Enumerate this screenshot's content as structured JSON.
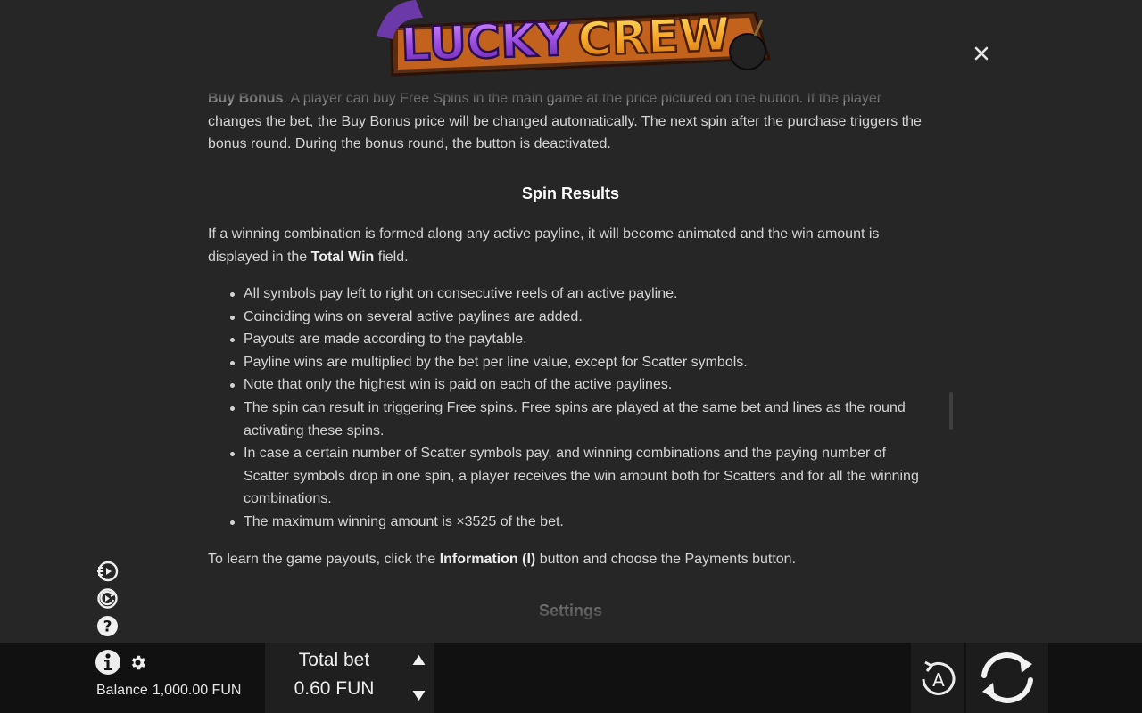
{
  "header": {
    "logo_word1": "LUCKY",
    "logo_word2": "CREW",
    "close_icon": "close-icon"
  },
  "rules": {
    "buy_bonus": {
      "term": "Buy Bonus",
      "text": ". A player can buy Free Spins in the main game at the price pictured on the button. If the player changes the bet, the Buy Bonus price will be changed automatically. The next spin after the purchase triggers the bonus round. During the bonus round, the button is deactivated."
    },
    "spin_results_heading": "Spin Results",
    "spin_results_intro": {
      "before": "If a winning combination is formed along any active payline, it will become animated and the win amount is displayed in the ",
      "bold": "Total Win",
      "after": " field."
    },
    "bullets": [
      "All symbols pay left to right on consecutive reels of an active payline.",
      "Coinciding wins on several active paylines are added.",
      "Payouts are made according to the paytable.",
      "Payline wins are multiplied by the bet per line value, except for Scatter symbols.",
      "Note that only the highest win is paid on each of the active paylines.",
      "The spin can result in triggering Free spins. Free spins are played at the same bet and lines as the round activating these spins.",
      "In case a certain number of Scatter symbols pay, and winning combinations and the paying number of Scatter symbols drop in one spin, a player receives the win amount both for Scatters and for all the winning combinations.",
      "The maximum winning amount is ×3525 of the bet."
    ],
    "learn": {
      "before": "To learn the game payouts, click the ",
      "bold": "Information (I)",
      "after": " button and choose the Payments button."
    },
    "settings_heading": "Settings"
  },
  "side_icons": [
    "quick-spin-icon",
    "autoplay-icon",
    "help-icon"
  ],
  "bottom_bar": {
    "balance_label": "Balance",
    "balance_value": "1,000.00 FUN",
    "total_bet_label": "Total bet",
    "total_bet_value": "0.60 FUN",
    "auto_label": "A",
    "colors": {
      "bar": "#111111",
      "panel": "#1f1f1f",
      "text": "#eeeeee"
    }
  },
  "colors": {
    "background": "#262626",
    "body_text": "#d4d4d4",
    "logo_purple": "#8a3fd6",
    "logo_orange": "#f2a42a"
  }
}
